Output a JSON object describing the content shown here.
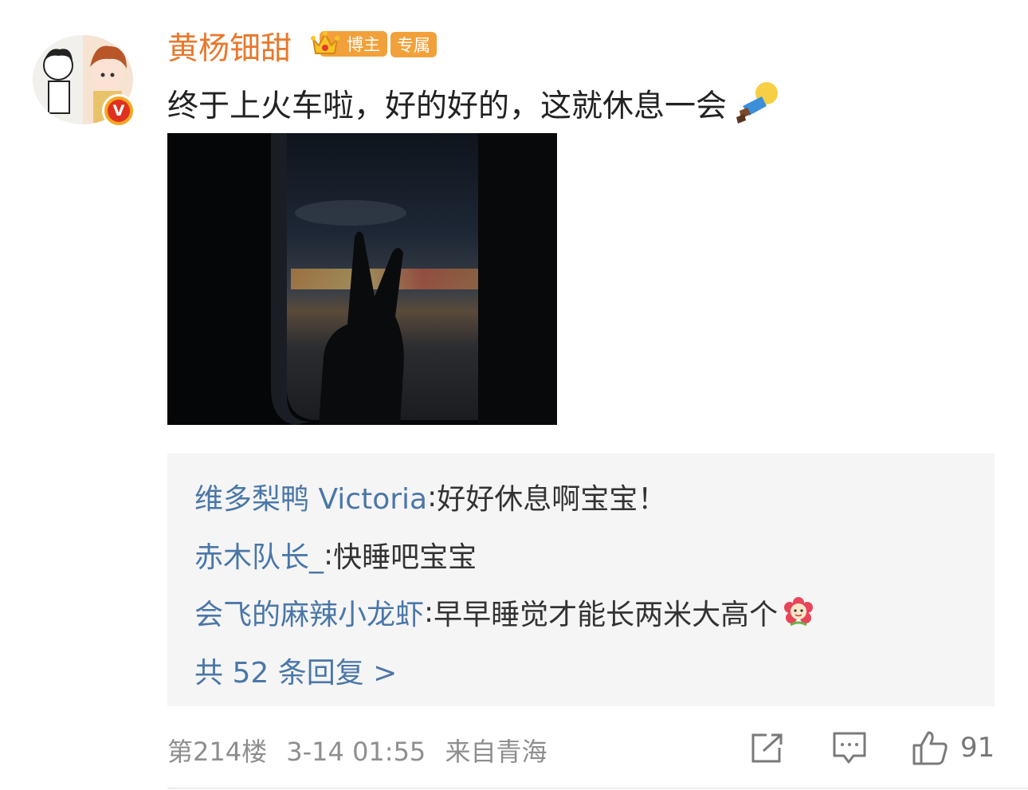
{
  "post": {
    "author": "黄杨钿甜",
    "badge_blogger": "博主",
    "badge_exclusive": "专属",
    "text": "终于上火车啦，好的好的，这就休息一会",
    "emoji_icon": "sleeping-person-icon"
  },
  "replies": [
    {
      "user": "维多梨鸭 Victoria",
      "text": "好好休息啊宝宝！"
    },
    {
      "user": "赤木队长_",
      "text": "快睡吧宝宝"
    },
    {
      "user": "会飞的麻辣小龙虾",
      "text": "早早睡觉才能长两米大高个",
      "emoji_icon": "flower-face-icon"
    }
  ],
  "more_replies": "共 52 条回复 >",
  "meta": {
    "floor": "第214楼",
    "time": "3-14 01:55",
    "source": "来自青海"
  },
  "actions": {
    "share_icon": "share-icon",
    "comment_icon": "comment-icon",
    "like_icon": "thumbs-up-icon",
    "like_count": "91"
  },
  "colors": {
    "username": "#e8782c",
    "reply_user": "#4a77a8",
    "badge": "#f2a13a",
    "reply_bg": "#f5f5f5"
  }
}
